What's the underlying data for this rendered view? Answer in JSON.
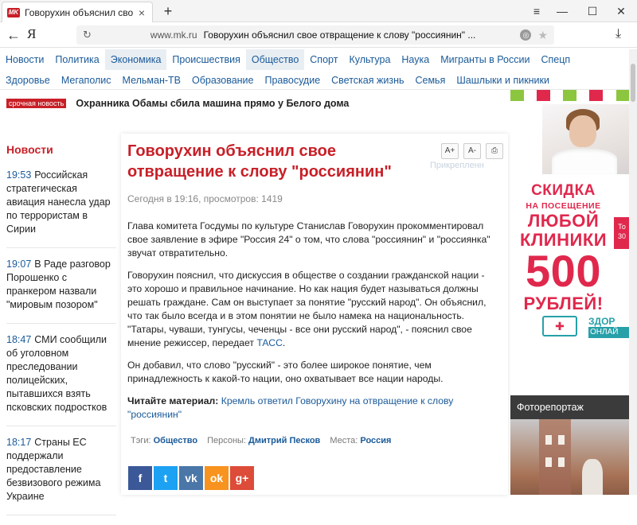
{
  "browser": {
    "tab_favicon": "MK",
    "tab_title": "Говорухин объяснил сво",
    "url_host": "www.mk.ru",
    "url_title": "Говорухин объяснил свое отвращение к слову \"россиянин\" ...",
    "logo": "Я"
  },
  "nav_primary": [
    "Новости",
    "Политика",
    "Экономика",
    "Происшествия",
    "Общество",
    "Спорт",
    "Культура",
    "Наука",
    "Мигранты в России",
    "Спецп"
  ],
  "nav_secondary": [
    "Здоровье",
    "Мегаполис",
    "Мельман-ТВ",
    "Образование",
    "Правосудие",
    "Светская жизнь",
    "Семья",
    "Шашлыки и пикники"
  ],
  "urgent": {
    "badge": "срочная новость",
    "text": "Охранника Обамы сбила машина прямо у Белого дома"
  },
  "news": {
    "heading": "Новости",
    "items": [
      {
        "time": "19:53",
        "text": "Российская стратегическая авиация нанесла удар по террористам в Сирии"
      },
      {
        "time": "19:07",
        "text": "В Раде разговор Порошенко с пранкером назвали \"мировым позором\""
      },
      {
        "time": "18:47",
        "text": "СМИ сообщили об уголовном преследовании полицейских, пытавшихся взять псковских подростков"
      },
      {
        "time": "18:17",
        "text": "Страны ЕС поддержали предоставление безвизового режима Украине"
      }
    ]
  },
  "article": {
    "title": "Говорухин объяснил свое отвращение к слову \"россиянин\"",
    "font_large": "A+",
    "font_small": "A-",
    "print_icon": "print-icon",
    "ghost_label": "Прикрепленн",
    "meta": "Сегодня в 19:16, просмотров: 1419",
    "p1": "Глава комитета Госдумы по культуре Станислав Говорухин прокомментировал свое заявление в эфире \"Россия 24\" о том, что слова \"россиянин\" и \"россиянка\" звучат отвратительно.",
    "p2": "Говорухин пояснил, что дискуссия в обществе о создании гражданской нации - это хорошо и правильное начинание. Но как нация будет называться должны решать граждане. Сам он выступает за понятие \"русский народ\". Он объяснил, что так было всегда и в этом понятии не было намека на национальность. \"Татары, чуваши, тунгусы, чеченцы - все они русский народ\", - пояснил свое мнение режиссер, передает",
    "p2_link": "ТАСС",
    "p2_end": ".",
    "p3": "Он добавил, что слово \"русский\" - это более широкое понятие, чем принадлежность к какой-то нации, оно охватывает все нации народы.",
    "read_label": "Читайте материал:",
    "read_link": "Кремль ответил Говорухину на отвращение к слову \"россиянин\"",
    "tags": [
      {
        "label": "Тэги:",
        "value": "Общество"
      },
      {
        "label": "Персоны:",
        "value": "Дмитрий Песков"
      },
      {
        "label": "Места:",
        "value": "Россия"
      }
    ],
    "shares": [
      {
        "name": "facebook",
        "glyph": "f",
        "color": "#3b5998"
      },
      {
        "name": "twitter",
        "glyph": "t",
        "color": "#1da1f2"
      },
      {
        "name": "vkontakte",
        "glyph": "vk",
        "color": "#4a76a8"
      },
      {
        "name": "odnoklassniki",
        "glyph": "ok",
        "color": "#f7931e"
      },
      {
        "name": "google-plus",
        "glyph": "g+",
        "color": "#dd4b39"
      }
    ]
  },
  "ad": {
    "line1": "СКИДКА",
    "line2": "НА ПОСЕЩЕНИЕ",
    "line3": "ЛЮБОЙ",
    "line4": "КЛИНИКИ",
    "line5": "500",
    "line6": "РУБЛЕЙ!",
    "side": "То 30",
    "brand": "ЗДОР",
    "brand2": "ОНЛАЙ"
  },
  "photo": {
    "heading": "Фоторепортаж"
  },
  "colors": {
    "accent_red": "#c81f27",
    "link_blue": "#1a5a99",
    "ad_pink": "#e0284d"
  }
}
